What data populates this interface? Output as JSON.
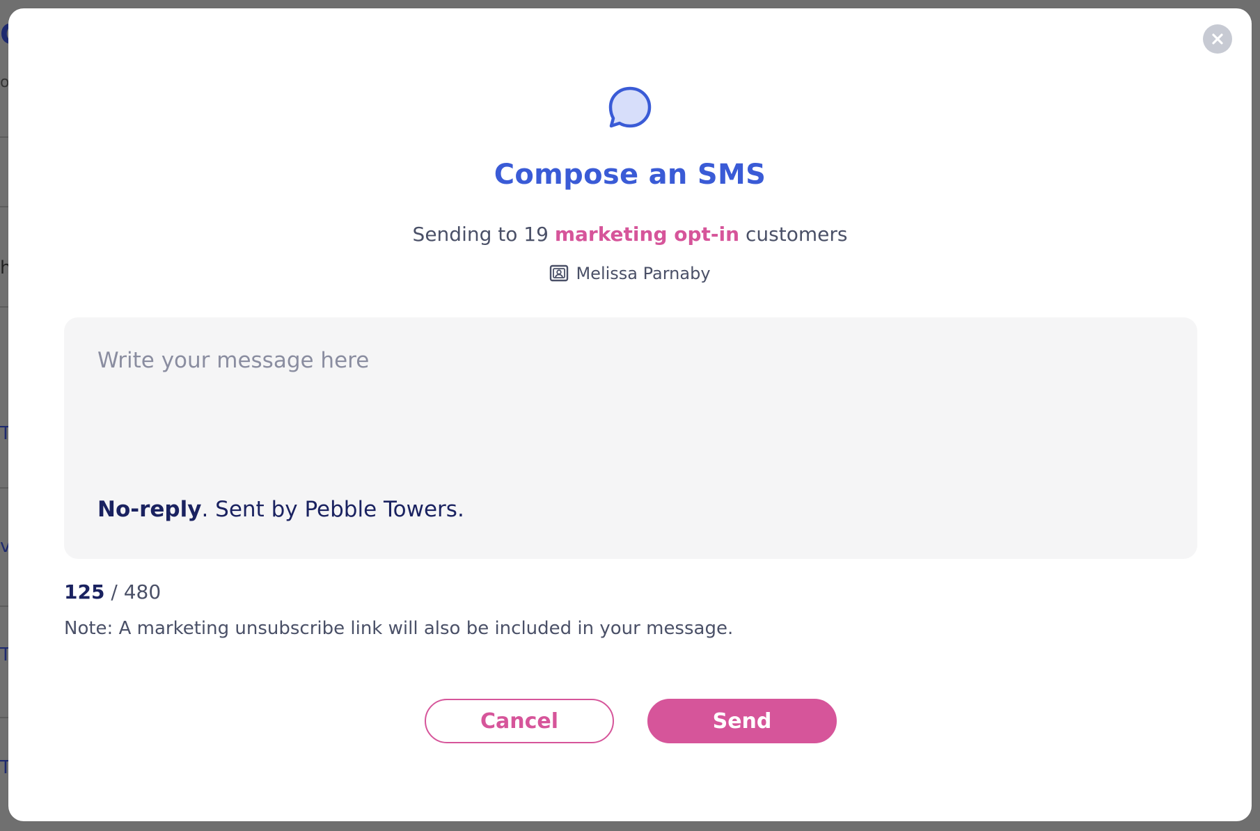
{
  "background": {
    "fragments": [
      "C",
      "o",
      "h",
      "T",
      "v",
      "T",
      "T"
    ]
  },
  "modal": {
    "close_icon": "close-icon",
    "header_icon": "chat-bubble-icon",
    "title": "Compose an SMS",
    "recipients": {
      "prefix": "Sending to 19",
      "highlight": "marketing opt-in",
      "suffix": "customers"
    },
    "sender": {
      "icon": "contact-card-icon",
      "name": "Melissa Parnaby"
    },
    "message": {
      "placeholder": "Write your message here",
      "value": "",
      "footer_strong": "No-reply",
      "footer_rest": ". Sent by Pebble Towers."
    },
    "counter": {
      "count": "125",
      "separator": " / ",
      "max": "480"
    },
    "note": "Note: A marketing unsubscribe link will also be included in your message.",
    "buttons": {
      "cancel": "Cancel",
      "send": "Send"
    }
  },
  "colors": {
    "accent_blue": "#3a5bd6",
    "accent_pink": "#d6559a",
    "text_dark": "#1a2260",
    "text_muted": "#4a5067",
    "input_bg": "#f5f5f6"
  }
}
